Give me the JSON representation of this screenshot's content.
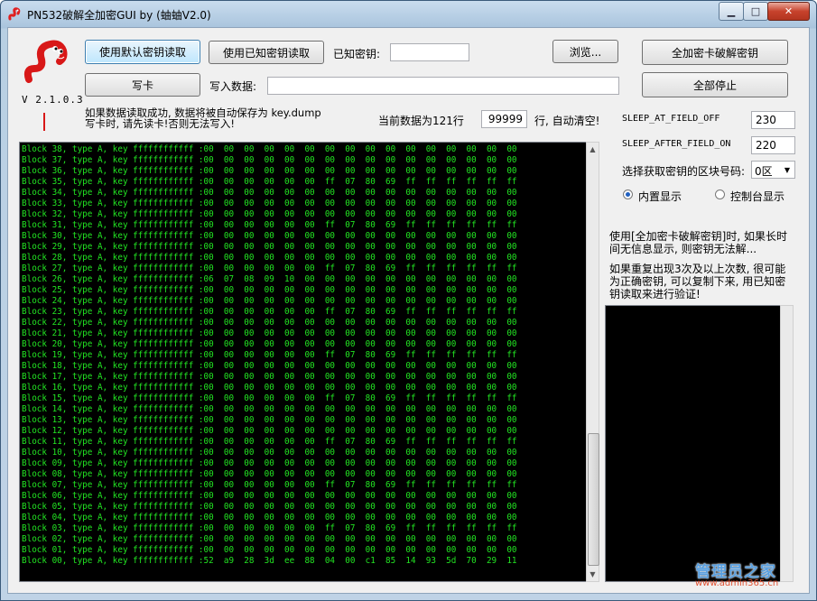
{
  "window": {
    "title": "PN532破解全加密GUI by (蚰蚰V2.0)",
    "version": "V 2.1.0.3",
    "buttons": {
      "minimize": "▁",
      "maximize": "□",
      "close": "✕"
    }
  },
  "toolbar": {
    "read_default_keys": "使用默认密钥读取",
    "read_known_keys": "使用已知密钥读取",
    "known_key_label": "已知密钥:",
    "known_key_value": "",
    "browse": "浏览...",
    "crack_full_encryption": "全加密卡破解密钥",
    "write_card": "写卡",
    "write_data_label": "写入数据:",
    "write_data_value": "",
    "stop_all": "全部停止"
  },
  "info": {
    "save_notice": "如果数据读取成功, 数据将被自动保存为 key.dump",
    "write_notice": "写卡时, 请先读卡!否则无法写入!",
    "current_data_prefix": "当前数据为121行",
    "line_limit": "99999",
    "current_data_suffix": "行, 自动清空!"
  },
  "settings": {
    "sleep_at_field_off_label": "SLEEP_AT_FIELD_OFF",
    "sleep_at_field_off_value": "230",
    "sleep_after_field_on_label": "SLEEP_AFTER_FIELD_ON",
    "sleep_after_field_on_value": "220",
    "block_select_label": "选择获取密钥的区块号码:",
    "block_select_value": "0区",
    "radio_builtin": "内置显示",
    "radio_console": "控制台显示",
    "radio_selected": "builtin"
  },
  "notes": {
    "note1": "使用[全加密卡破解密钥]时, 如果长时\n间无信息显示, 则密钥无法解...",
    "note2": "如果重复出现3次及以上次数, 很可能\n为正确密钥, 可以复制下来, 用已知密\n钥读取来进行验证!"
  },
  "dump_lines": [
    "Block 38, type A, key ffffffffffff :00  00  00  00  00  00  00  00  00  00  00  00  00  00  00  00",
    "Block 37, type A, key ffffffffffff :00  00  00  00  00  00  00  00  00  00  00  00  00  00  00  00",
    "Block 36, type A, key ffffffffffff :00  00  00  00  00  00  00  00  00  00  00  00  00  00  00  00",
    "Block 35, type A, key ffffffffffff :00  00  00  00  00  00  ff  07  80  69  ff  ff  ff  ff  ff  ff",
    "Block 34, type A, key ffffffffffff :00  00  00  00  00  00  00  00  00  00  00  00  00  00  00  00",
    "Block 33, type A, key ffffffffffff :00  00  00  00  00  00  00  00  00  00  00  00  00  00  00  00",
    "Block 32, type A, key ffffffffffff :00  00  00  00  00  00  00  00  00  00  00  00  00  00  00  00",
    "Block 31, type A, key ffffffffffff :00  00  00  00  00  00  ff  07  80  69  ff  ff  ff  ff  ff  ff",
    "Block 30, type A, key ffffffffffff :00  00  00  00  00  00  00  00  00  00  00  00  00  00  00  00",
    "Block 29, type A, key ffffffffffff :00  00  00  00  00  00  00  00  00  00  00  00  00  00  00  00",
    "Block 28, type A, key ffffffffffff :00  00  00  00  00  00  00  00  00  00  00  00  00  00  00  00",
    "Block 27, type A, key ffffffffffff :00  00  00  00  00  00  ff  07  80  69  ff  ff  ff  ff  ff  ff",
    "Block 26, type A, key ffffffffffff :06  07  08  09  10  00  00  00  00  00  00  00  00  00  00  00",
    "Block 25, type A, key ffffffffffff :00  00  00  00  00  00  00  00  00  00  00  00  00  00  00  00",
    "Block 24, type A, key ffffffffffff :00  00  00  00  00  00  00  00  00  00  00  00  00  00  00  00",
    "Block 23, type A, key ffffffffffff :00  00  00  00  00  00  ff  07  80  69  ff  ff  ff  ff  ff  ff",
    "Block 22, type A, key ffffffffffff :00  00  00  00  00  00  00  00  00  00  00  00  00  00  00  00",
    "Block 21, type A, key ffffffffffff :00  00  00  00  00  00  00  00  00  00  00  00  00  00  00  00",
    "Block 20, type A, key ffffffffffff :00  00  00  00  00  00  00  00  00  00  00  00  00  00  00  00",
    "Block 19, type A, key ffffffffffff :00  00  00  00  00  00  ff  07  80  69  ff  ff  ff  ff  ff  ff",
    "Block 18, type A, key ffffffffffff :00  00  00  00  00  00  00  00  00  00  00  00  00  00  00  00",
    "Block 17, type A, key ffffffffffff :00  00  00  00  00  00  00  00  00  00  00  00  00  00  00  00",
    "Block 16, type A, key ffffffffffff :00  00  00  00  00  00  00  00  00  00  00  00  00  00  00  00",
    "Block 15, type A, key ffffffffffff :00  00  00  00  00  00  ff  07  80  69  ff  ff  ff  ff  ff  ff",
    "Block 14, type A, key ffffffffffff :00  00  00  00  00  00  00  00  00  00  00  00  00  00  00  00",
    "Block 13, type A, key ffffffffffff :00  00  00  00  00  00  00  00  00  00  00  00  00  00  00  00",
    "Block 12, type A, key ffffffffffff :00  00  00  00  00  00  00  00  00  00  00  00  00  00  00  00",
    "Block 11, type A, key ffffffffffff :00  00  00  00  00  00  ff  07  80  69  ff  ff  ff  ff  ff  ff",
    "Block 10, type A, key ffffffffffff :00  00  00  00  00  00  00  00  00  00  00  00  00  00  00  00",
    "Block 09, type A, key ffffffffffff :00  00  00  00  00  00  00  00  00  00  00  00  00  00  00  00",
    "Block 08, type A, key ffffffffffff :00  00  00  00  00  00  00  00  00  00  00  00  00  00  00  00",
    "Block 07, type A, key ffffffffffff :00  00  00  00  00  00  ff  07  80  69  ff  ff  ff  ff  ff  ff",
    "Block 06, type A, key ffffffffffff :00  00  00  00  00  00  00  00  00  00  00  00  00  00  00  00",
    "Block 05, type A, key ffffffffffff :00  00  00  00  00  00  00  00  00  00  00  00  00  00  00  00",
    "Block 04, type A, key ffffffffffff :00  00  00  00  00  00  00  00  00  00  00  00  00  00  00  00",
    "Block 03, type A, key ffffffffffff :00  00  00  00  00  00  ff  07  80  69  ff  ff  ff  ff  ff  ff",
    "Block 02, type A, key ffffffffffff :00  00  00  00  00  00  00  00  00  00  00  00  00  00  00  00",
    "Block 01, type A, key ffffffffffff :00  00  00  00  00  00  00  00  00  00  00  00  00  00  00  00",
    "Block 00, type A, key ffffffffffff :52  a9  28  3d  ee  88  04  00  c1  85  14  93  5d  70  29  11"
  ],
  "watermark": {
    "main": "管理员之家",
    "sub": "www.admin365.cn"
  },
  "colors": {
    "dump_text": "#22e422",
    "console_bg": "#000000",
    "logo": "#e02020"
  }
}
